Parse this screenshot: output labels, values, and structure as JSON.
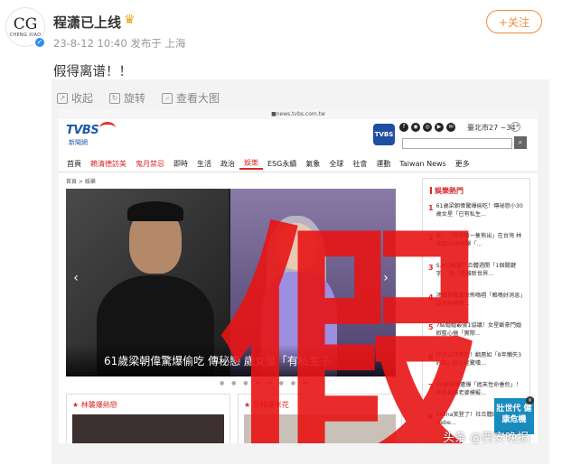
{
  "post": {
    "avatar_monogram": "CG",
    "avatar_sub": "CHENG XIAO",
    "username": "程潇已上线",
    "meta": "23-8-12 10:40  发布于 上海",
    "follow_label": "+关注",
    "text": "假得离谱！！"
  },
  "media_bar": {
    "collapse": "收起",
    "rotate": "旋转",
    "view_large": "查看大图"
  },
  "screenshot": {
    "url": "■news.tvbs.com.tw",
    "logo": "TVBS",
    "logo_sub": "新聞網",
    "app_icon": "TVBS",
    "social": [
      "f",
      "◉",
      "◎",
      "▶",
      "✉"
    ],
    "weather": "臺北市27 ~34°",
    "nav": [
      {
        "label": "首頁",
        "style": "normal"
      },
      {
        "label": "賴清德訪美",
        "style": "red"
      },
      {
        "label": "鬼月禁忌",
        "style": "red"
      },
      {
        "label": "即時",
        "style": "normal"
      },
      {
        "label": "生活",
        "style": "normal"
      },
      {
        "label": "政治",
        "style": "normal"
      },
      {
        "label": "娛樂",
        "style": "active"
      },
      {
        "label": "ESG永續",
        "style": "normal"
      },
      {
        "label": "氣象",
        "style": "normal"
      },
      {
        "label": "全球",
        "style": "normal"
      },
      {
        "label": "社會",
        "style": "normal"
      },
      {
        "label": "運動",
        "style": "normal"
      },
      {
        "label": "Taiwan News",
        "style": "normal"
      },
      {
        "label": "更多",
        "style": "normal"
      }
    ],
    "breadcrumb": "首頁 > 娛樂",
    "hero_caption": "61歲梁朝偉驚爆偷吃 傳秘戀 歲女星「有私生子",
    "card1_title": "★ 林襲爆熱戀",
    "card2_title": "★ 日韓爆米花",
    "side_title": "娛樂熱門",
    "side_items": [
      {
        "n": "1",
        "text": "61歲梁朝偉驚爆偷吃！傳祕戀小30歲女星「已有私生..."
      },
      {
        "n": "2",
        "text": "狂！「世界第一隻熊出」在台灣 林國嬰30年抨擊「..."
      },
      {
        "n": "3",
        "text": "S.H.E解散？合體週開「1個關鍵字」 粉「真難新世界..."
      },
      {
        "n": "4",
        "text": "鴻維英羅嘉恐怖鳴唱「賴鳴好消息」 認性極爆瞬..."
      },
      {
        "n": "5",
        "text": "7結婚婚最後1協議！女星斷豪門婚 掀藍心搞「實際..."
      },
      {
        "n": "6",
        "text": "仔仔上月興吃！翻唇如「8年懶失3好友」抄心經驚嘆..."
      },
      {
        "n": "7",
        "text": "60歲視帝遭爆「癌末性命垂危」！表哥自曝老婆模擬..."
      },
      {
        "n": "8",
        "text": "Selina笑登了！社合體Ella、Hebe..."
      }
    ],
    "ad_text": "壯世代 健康危機",
    "ad_close": "×"
  },
  "overlay_text": "假",
  "watermark": "头条 @西安晚报"
}
